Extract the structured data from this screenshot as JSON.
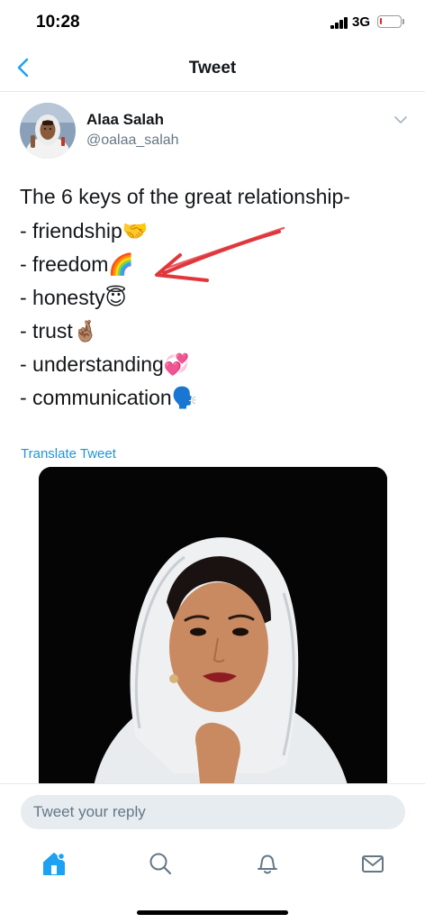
{
  "status_bar": {
    "time": "10:28",
    "network": "3G",
    "battery_level": 0.1,
    "battery_color": "#e0262a"
  },
  "nav": {
    "back_icon": "chevron-left-icon",
    "title": "Tweet"
  },
  "tweet": {
    "author_name": "Alaa Salah",
    "author_handle": "@oalaa_salah",
    "text_lines": [
      "The 6 keys of the great relationship-",
      "- friendship🤝",
      "- freedom🌈",
      "- honesty😇",
      "- trust🤞🏽",
      "- understanding💞",
      "- communication🗣️"
    ],
    "translate_label": "Translate Tweet"
  },
  "reply": {
    "placeholder": "Tweet your reply"
  },
  "tabs": [
    {
      "icon": "home-icon",
      "active": true
    },
    {
      "icon": "search-icon",
      "active": false
    },
    {
      "icon": "notifications-bell-icon",
      "active": false
    },
    {
      "icon": "messages-envelope-icon",
      "active": false
    }
  ],
  "colors": {
    "accent": "#1da1f2",
    "link": "#1b95e0",
    "text": "#14171a",
    "secondary": "#657786",
    "annotation_arrow": "#e0373c"
  }
}
